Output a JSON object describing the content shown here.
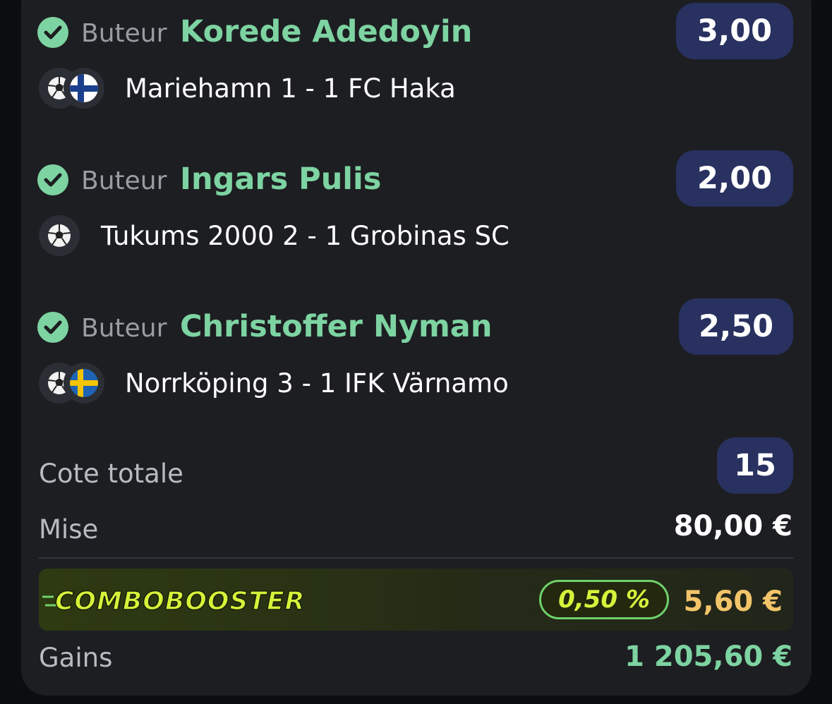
{
  "bets": [
    {
      "market": "Buteur",
      "player": "Korede Adedoyin",
      "odds": "3,00",
      "match": "Mariehamn 1 - 1 FC Haka",
      "flag": "finland-flag-icon"
    },
    {
      "market": "Buteur",
      "player": "Ingars Pulis",
      "odds": "2,00",
      "match": "Tukums 2000 2 - 1 Grobinas SC",
      "flag": null
    },
    {
      "market": "Buteur",
      "player": "Christoffer Nyman",
      "odds": "2,50",
      "match": "Norrköping 3 - 1 IFK Värnamo",
      "flag": "sweden-flag-icon"
    }
  ],
  "summary": {
    "total_odds_label": "Cote totale",
    "total_odds": "15",
    "stake_label": "Mise",
    "stake": "80,00 €",
    "booster_logo": "COMBOBOOSTER",
    "booster_pct": "0,50 %",
    "booster_amount": "5,60 €",
    "gains_label": "Gains",
    "gains": "1 205,60 €"
  },
  "colors": {
    "accent_green": "#7dd3a1",
    "odds_bg": "#28315f",
    "booster_yellow": "#d6f33a",
    "booster_amount": "#f2c46a"
  }
}
